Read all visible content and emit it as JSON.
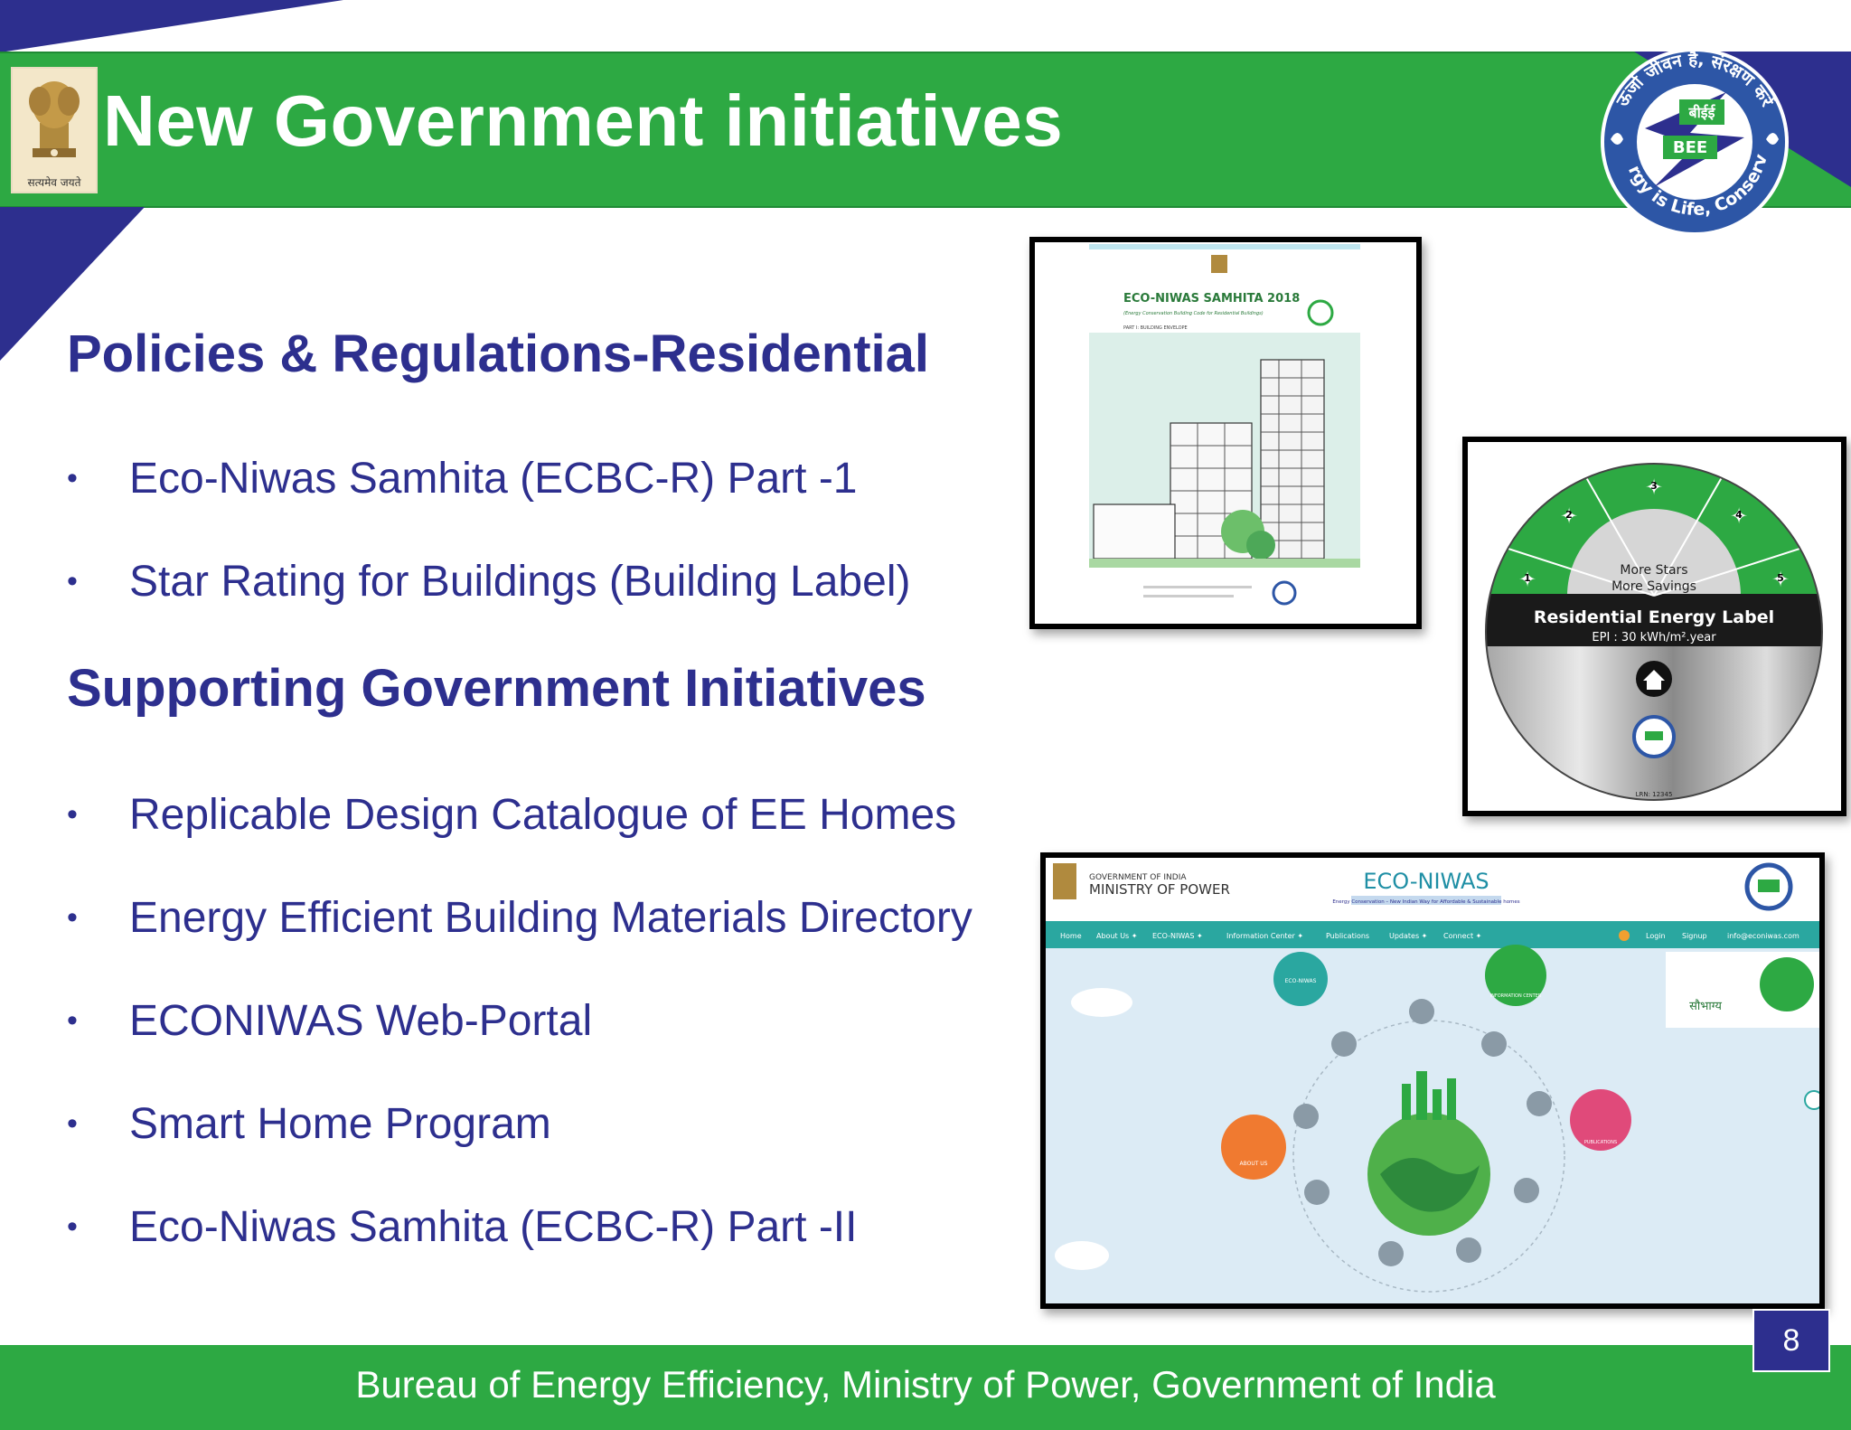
{
  "header": {
    "title": "New Government initiatives",
    "emblem_motto": "सत्यमेव जयते",
    "logo": {
      "top_text": "ऊर्जा जीवन है, संरक्षण करें",
      "hindi_abbr": "बीईई",
      "abbr": "BEE",
      "bottom_text": "Energy is Life, Conserve it"
    }
  },
  "sections": [
    {
      "heading": "Policies & Regulations-Residential",
      "items": [
        "Eco-Niwas Samhita (ECBC-R) Part -1",
        "Star Rating for Buildings (Building Label)"
      ]
    },
    {
      "heading": "Supporting Government Initiatives",
      "items": [
        "Replicable Design Catalogue of EE Homes",
        "Energy Efficient Building Materials Directory",
        "ECONIWAS Web-Portal",
        "Smart Home Program",
        "Eco-Niwas Samhita (ECBC-R) Part -II"
      ]
    }
  ],
  "bullet_glyph": "•",
  "images": {
    "cover": {
      "title": "ECO-NIWAS SAMHITA 2018",
      "subtitle": "(Energy Conservation Building Code for Residential Buildings)",
      "part": "PART I: BUILDING ENVELOPE"
    },
    "label": {
      "stars": [
        "1",
        "2",
        "3",
        "4",
        "5"
      ],
      "tagline_1": "More Stars",
      "tagline_2": "More Savings",
      "title": "Residential Energy Label",
      "epi": "EPI : 30 kWh/m².year",
      "lrn": "LRN: 12345"
    },
    "portal": {
      "gov_line_1": "GOVERNMENT OF INDIA",
      "gov_line_2": "MINISTRY OF POWER",
      "site_title": "ECO-NIWAS",
      "site_tagline": "Energy Conservation – New Indian Way for Affordable & Sustainable homes",
      "nav": [
        "Home",
        "About Us ✦",
        "ECO-NIWAS ✦",
        "Information Center ✦",
        "Publications",
        "Updates ✦",
        "Connect ✦"
      ],
      "nav_right": [
        "Login",
        "Signup",
        "info@econiwas.com"
      ],
      "bubbles": [
        "ECO-NIWAS",
        "INFORMATION CENTER",
        "ABOUT US",
        "PUBLICATIONS"
      ],
      "saubhagya": "सौभाग्य"
    }
  },
  "footer": {
    "text": "Bureau of Energy Efficiency, Ministry of Power, Government of India",
    "page_number": "8"
  },
  "colors": {
    "green": "#2da943",
    "navy": "#2d2f8e",
    "text_blue": "#2d2f8e"
  }
}
